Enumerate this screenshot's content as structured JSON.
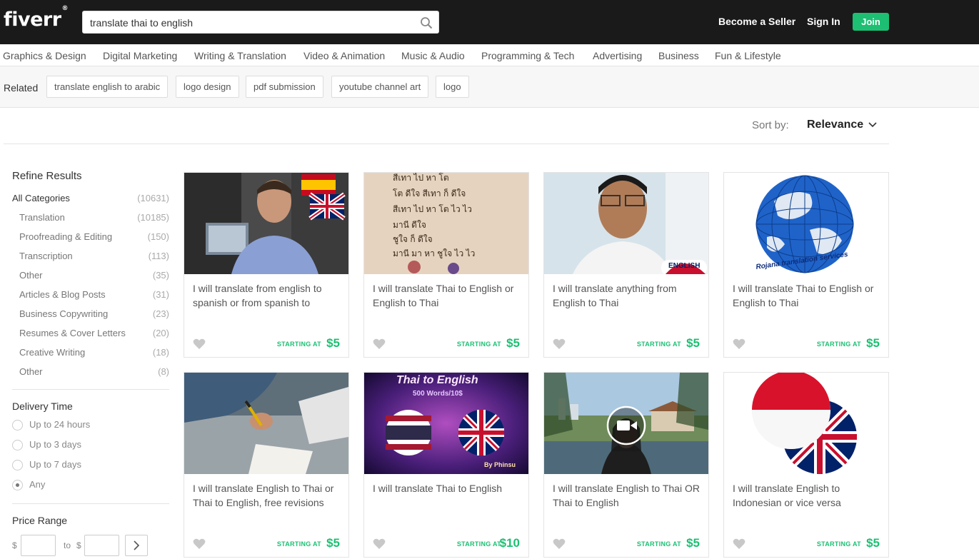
{
  "header": {
    "logo": "fiverr",
    "logo_mark": "®",
    "search_value": "translate thai to english",
    "become_seller": "Become a Seller",
    "sign_in": "Sign In",
    "join": "Join"
  },
  "categories": [
    "Graphics & Design",
    "Digital Marketing",
    "Writing & Translation",
    "Video & Animation",
    "Music & Audio",
    "Programming & Tech",
    "Advertising",
    "Business",
    "Fun & Lifestyle"
  ],
  "related": {
    "label": "Related",
    "tags": [
      "translate english to arabic",
      "logo design",
      "pdf submission",
      "youtube channel art",
      "logo"
    ]
  },
  "sort": {
    "label": "Sort by:",
    "value": "Relevance"
  },
  "sidebar": {
    "title": "Refine Results",
    "all_categories": {
      "name": "All Categories",
      "count": "(10631)"
    },
    "subcategories": [
      {
        "name": "Translation",
        "count": "(10185)"
      },
      {
        "name": "Proofreading & Editing",
        "count": "(150)"
      },
      {
        "name": "Transcription",
        "count": "(113)"
      },
      {
        "name": "Other",
        "count": "(35)"
      },
      {
        "name": "Articles & Blog Posts",
        "count": "(31)"
      },
      {
        "name": "Business Copywriting",
        "count": "(23)"
      },
      {
        "name": "Resumes & Cover Letters",
        "count": "(20)"
      },
      {
        "name": "Creative Writing",
        "count": "(18)"
      },
      {
        "name": "Other",
        "count": "(8)"
      }
    ],
    "delivery_title": "Delivery Time",
    "delivery_options": [
      "Up to 24 hours",
      "Up to 3 days",
      "Up to 7 days",
      "Any"
    ],
    "delivery_selected": "Any",
    "price_title": "Price Range",
    "price_from_symbol": "$",
    "price_to_label": "to",
    "price_to_symbol": "$",
    "price_go": "›"
  },
  "gigs": [
    {
      "title": "I will translate from english to spanish or from spanish to",
      "starting": "STARTING AT",
      "price": "$5"
    },
    {
      "title": "I will translate Thai to English or English to Thai",
      "starting": "STARTING AT",
      "price": "$5",
      "thumb_text": [
        "สีเทา ไป หา โต",
        "โต ดีใจ สีเทา ก็ ดีใจ",
        "สีเทา ไป หา โต ไว ไว",
        "มานี ดีใจ",
        "ชูใจ ก็ ดีใจ",
        "มานี มา หา ชูใจ ไว ไว"
      ]
    },
    {
      "title": "I will translate anything from English to Thai",
      "starting": "STARTING AT",
      "price": "$5",
      "thumb_text": [
        "ENGLISH"
      ]
    },
    {
      "title": "I will translate Thai to English or English to Thai",
      "starting": "STARTING AT",
      "price": "$5",
      "thumb_text": [
        "Rojana translation services"
      ]
    },
    {
      "title": "I will translate English to Thai or Thai to English, free revisions",
      "starting": "STARTING AT",
      "price": "$5"
    },
    {
      "title": "I will translate Thai to English",
      "starting": "STARTING AT",
      "price": "$10",
      "thumb_text": [
        "Thai to English",
        "500 Words/10$",
        "By Phinsu"
      ]
    },
    {
      "title": "I will translate English to Thai OR Thai to English",
      "starting": "STARTING AT",
      "price": "$5"
    },
    {
      "title": "I will translate English to Indonesian or vice versa",
      "starting": "STARTING AT",
      "price": "$5"
    }
  ],
  "colors": {
    "brand_green": "#1dbf73",
    "header_bg": "#1a1a1a"
  },
  "icons": [
    "search-icon",
    "chevron-down-icon",
    "heart-icon",
    "chevron-right-icon"
  ]
}
